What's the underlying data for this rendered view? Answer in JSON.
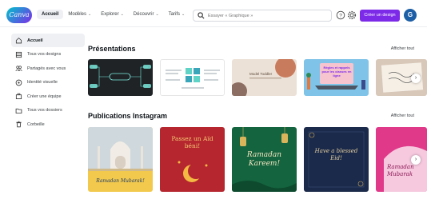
{
  "header": {
    "logo_text": "Canva",
    "nav": [
      {
        "label": "Accueil",
        "active": true,
        "chevron": false
      },
      {
        "label": "Modèles",
        "chevron": true
      },
      {
        "label": "Explorer",
        "chevron": true
      },
      {
        "label": "Découvrir",
        "chevron": true
      },
      {
        "label": "Tarifs",
        "chevron": true
      }
    ],
    "search_placeholder": "Essayer « Graphique »",
    "help_icon": "help-icon",
    "settings_icon": "gear-icon",
    "create_button": "Créer un design",
    "avatar_initial": "G",
    "brand_color": "#7d2ae8"
  },
  "sidebar": {
    "items": [
      {
        "label": "Accueil",
        "icon": "home-icon",
        "active": true
      },
      {
        "label": "Tous vos designs",
        "icon": "grid-icon"
      },
      {
        "label": "Partagés avec vous",
        "icon": "users-icon"
      },
      {
        "label": "Identité visuelle",
        "icon": "brand-icon"
      },
      {
        "label": "Créer une équipe",
        "icon": "team-icon"
      },
      {
        "label": "Tous vos dossiers",
        "icon": "folder-icon"
      },
      {
        "label": "Corbeille",
        "icon": "trash-icon"
      }
    ]
  },
  "sections": {
    "presentations": {
      "title": "Présentations",
      "see_all": "Afficher tout",
      "cards": [
        {
          "name": "dark-flowchart",
          "bg": "#1f2326"
        },
        {
          "name": "teal-diagram",
          "bg": "#ffffff"
        },
        {
          "name": "beige-shapes",
          "bg": "#ece1d6",
          "text": "Model Toddler"
        },
        {
          "name": "lightblue-laptop",
          "bg": "#7fc4e8",
          "text": "Règles et rappels pour les classes en ligne"
        },
        {
          "name": "paper-quote",
          "bg": "#d8c8b9"
        }
      ]
    },
    "instagram": {
      "title": "Publications Instagram",
      "see_all": "Afficher tout",
      "cards": [
        {
          "name": "taj-mahal",
          "bg": "#f2c94c",
          "text": "Ramadan Mubarak!"
        },
        {
          "name": "red-aid",
          "bg": "#b5262f",
          "text": "Passez un Aïd béni!"
        },
        {
          "name": "green-ramadan",
          "bg": "#14643f",
          "text": "Ramadan Kareem!"
        },
        {
          "name": "navy-eid",
          "bg": "#1b2a4a",
          "text": "Have a blessed Eid!"
        },
        {
          "name": "pink-ramadan",
          "bg": "#e0398a",
          "text": "Ramadan Mubarak"
        }
      ]
    }
  }
}
